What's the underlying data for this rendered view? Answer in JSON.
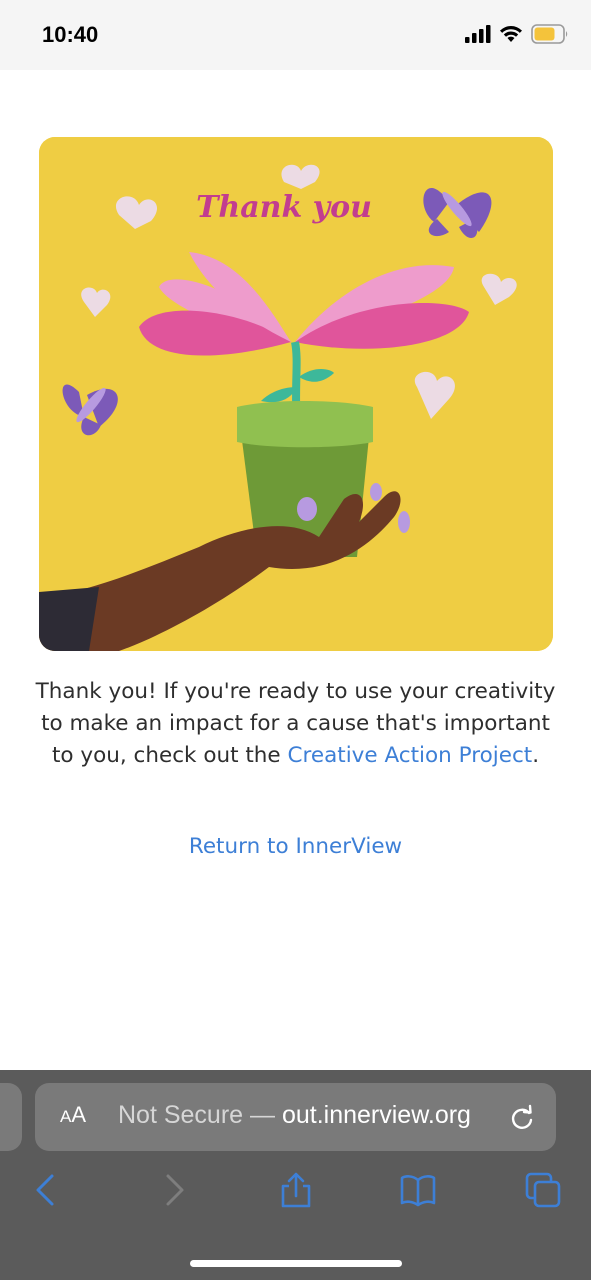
{
  "status": {
    "time": "10:40"
  },
  "illustration": {
    "lettering": "Thank you"
  },
  "message": {
    "text_before": "Thank you! If you're ready to use your creativity to make an impact for a cause that's important to you, check out the ",
    "link_text": "Creative Action Project",
    "text_after": "."
  },
  "return_link": "Return to InnerView",
  "browser": {
    "aa_large": "A",
    "aa_small": "A",
    "url_prefix": "Not Secure — ",
    "url_domain": "out.innerview.org"
  },
  "colors": {
    "link": "#3d7fd6",
    "illustration_background": "#efcd43",
    "toolbar": "#5b5b5b",
    "toolbar_icon": "#3d7fd6",
    "battery": "#f4c33b"
  },
  "icons": [
    "signal-icon",
    "wifi-icon",
    "battery-icon",
    "reload-icon",
    "back-icon",
    "forward-icon",
    "share-icon",
    "bookmarks-icon",
    "tabs-icon"
  ]
}
